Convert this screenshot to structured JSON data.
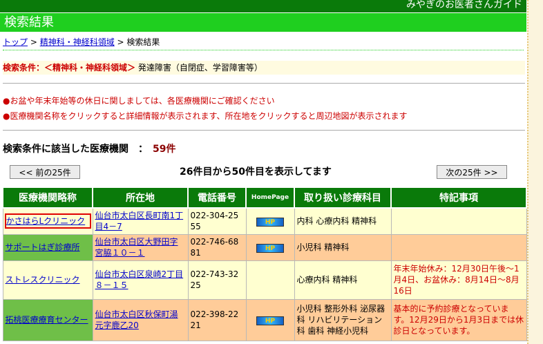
{
  "site": {
    "banner": "みやぎのお医者さんガイド"
  },
  "page": {
    "title": "検索結果"
  },
  "breadcrumb": {
    "top": "トップ",
    "sep1": " > ",
    "category": "精神科・神経科領域",
    "sep2": " > ",
    "current": "検索結果"
  },
  "condition": {
    "label": "検索条件：＜精神科・神経科領域＞",
    "value": " 発達障害（自閉症、学習障害等）"
  },
  "notices": [
    "●お盆や年末年始等の休日に関しましては、各医療機関にご確認ください",
    "●医療機関名称をクリックすると詳細情報が表示されます、所在地をクリックすると周辺地図が表示されます"
  ],
  "count": {
    "label": "検索条件に該当した医療機関　：　",
    "value": "59件"
  },
  "pager": {
    "prev": "<< 前の25件",
    "next": "次の25件 >>",
    "range": "26件目から50件目を表示してます"
  },
  "table": {
    "headers": [
      "医療機関略称",
      "所在地",
      "電話番号",
      "HomePage",
      "取り扱い診療科目",
      "特記事項"
    ],
    "hp_icon_label": "HP",
    "rows": [
      {
        "name": "かさはらLクリニック",
        "address": "仙台市太白区長町南1丁目4－7",
        "phone": "022-304-2555",
        "hp": true,
        "depts": "内科 心療内科 精神科",
        "note": ""
      },
      {
        "name": "サポートはぎ診療所",
        "address": "仙台市太白区大野田字宮脇１０－１",
        "phone": "022-746-6881",
        "hp": true,
        "depts": "小児科 精神科",
        "note": ""
      },
      {
        "name": "ストレスクリニック",
        "address": "仙台市太白区泉崎2丁目８－１５",
        "phone": "022-743-3225",
        "hp": false,
        "depts": "心療内科 精神科",
        "note": "年末年始休み：12月30日午後～1月4日、お盆休み：8月14日～8月16日"
      },
      {
        "name": "拓桃医療療育センター",
        "address": "仙台市太白区秋保町湯元字鹿乙20",
        "phone": "022-398-2221",
        "hp": true,
        "depts": "小児科 整形外科 泌尿器科 リハビリテーション科 歯科 神経小児科",
        "note": "基本的に予約診療となっています。12月29日から1月3日までは休診日となっています。"
      }
    ]
  }
}
